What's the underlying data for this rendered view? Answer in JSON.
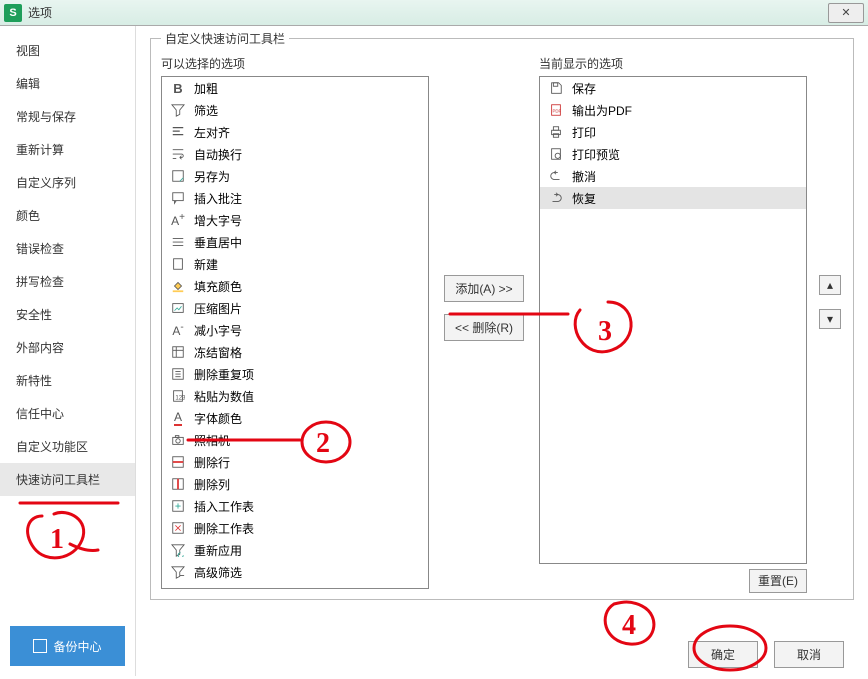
{
  "window": {
    "title": "选项",
    "close_glyph": "✕"
  },
  "sidebar": {
    "items": [
      {
        "label": "视图"
      },
      {
        "label": "编辑"
      },
      {
        "label": "常规与保存"
      },
      {
        "label": "重新计算"
      },
      {
        "label": "自定义序列"
      },
      {
        "label": "颜色"
      },
      {
        "label": "错误检查"
      },
      {
        "label": "拼写检查"
      },
      {
        "label": "安全性"
      },
      {
        "label": "外部内容"
      },
      {
        "label": "新特性"
      },
      {
        "label": "信任中心"
      },
      {
        "label": "自定义功能区"
      },
      {
        "label": "快速访问工具栏"
      }
    ],
    "active_index": 13,
    "backup_label": "备份中心"
  },
  "group": {
    "legend": "自定义快速访问工具栏",
    "available_label": "可以选择的选项",
    "current_label": "当前显示的选项",
    "add_button": "添加(A) >>",
    "remove_button": "<< 删除(R)",
    "reset_button": "重置(E)",
    "up_glyph": "▴",
    "down_glyph": "▾"
  },
  "available": [
    {
      "icon": "bold-icon",
      "label": "加粗"
    },
    {
      "icon": "filter-icon",
      "label": "筛选"
    },
    {
      "icon": "align-left-icon",
      "label": "左对齐"
    },
    {
      "icon": "wrap-text-icon",
      "label": "自动换行"
    },
    {
      "icon": "save-as-icon",
      "label": "另存为"
    },
    {
      "icon": "insert-comment-icon",
      "label": "插入批注"
    },
    {
      "icon": "increase-font-icon",
      "label": "增大字号"
    },
    {
      "icon": "vertical-center-icon",
      "label": "垂直居中"
    },
    {
      "icon": "new-doc-icon",
      "label": "新建"
    },
    {
      "icon": "fill-color-icon",
      "label": "填充颜色"
    },
    {
      "icon": "compress-image-icon",
      "label": "压缩图片"
    },
    {
      "icon": "decrease-font-icon",
      "label": "减小字号"
    },
    {
      "icon": "freeze-panes-icon",
      "label": "冻结窗格"
    },
    {
      "icon": "remove-duplicates-icon",
      "label": "删除重复项"
    },
    {
      "icon": "paste-values-icon",
      "label": "粘贴为数值"
    },
    {
      "icon": "font-color-icon",
      "label": "字体颜色"
    },
    {
      "icon": "camera-icon",
      "label": "照相机"
    },
    {
      "icon": "delete-row-icon",
      "label": "删除行"
    },
    {
      "icon": "delete-column-icon",
      "label": "删除列"
    },
    {
      "icon": "insert-sheet-icon",
      "label": "插入工作表"
    },
    {
      "icon": "delete-sheet-icon",
      "label": "删除工作表"
    },
    {
      "icon": "reapply-icon",
      "label": "重新应用"
    },
    {
      "icon": "advanced-filter-icon",
      "label": "高级筛选"
    }
  ],
  "current": [
    {
      "icon": "save-icon",
      "label": "保存"
    },
    {
      "icon": "export-pdf-icon",
      "label": "输出为PDF"
    },
    {
      "icon": "print-icon",
      "label": "打印"
    },
    {
      "icon": "print-preview-icon",
      "label": "打印预览"
    },
    {
      "icon": "undo-icon",
      "label": "撤消"
    },
    {
      "icon": "redo-icon",
      "label": "恢复",
      "selected": true
    }
  ],
  "footer": {
    "ok": "确定",
    "cancel": "取消"
  },
  "annotations": {
    "one": "1",
    "two": "2",
    "three": "3",
    "four": "4"
  }
}
